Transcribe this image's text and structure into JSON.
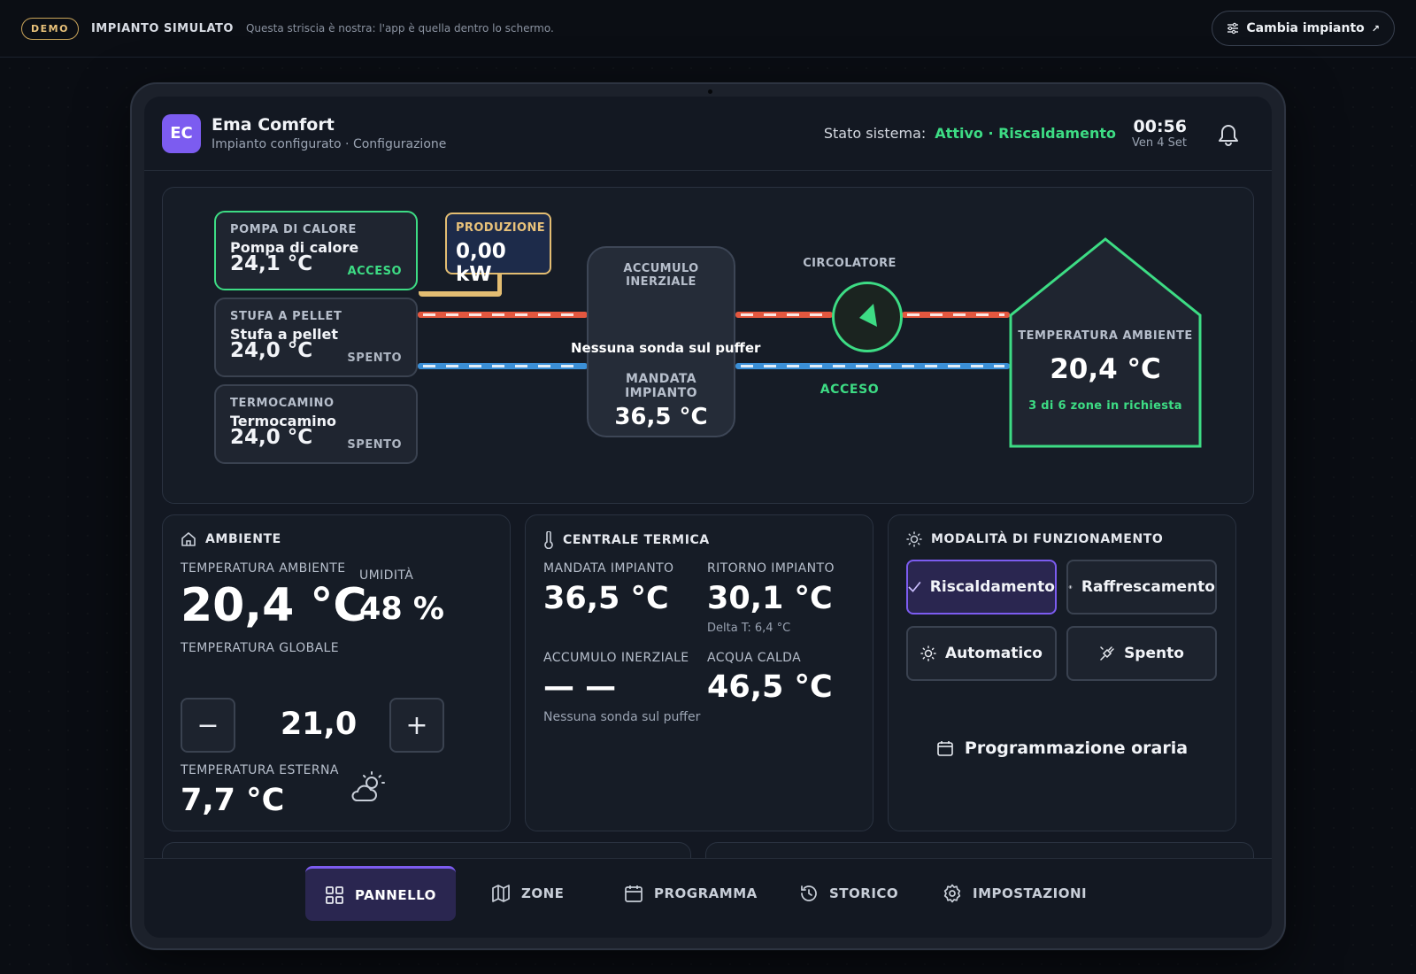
{
  "strip": {
    "badge": "DEMO",
    "title": "IMPIANTO SIMULATO",
    "note": "Questa striscia è nostra: l'app è quella dentro lo schermo.",
    "switch_label": "Cambia impianto",
    "switch_arrow": "↗"
  },
  "app": {
    "logo_initials": "EC",
    "name": "Ema Comfort",
    "subtitle": "Impianto configurato · Configurazione",
    "status_label": "Stato sistema:",
    "status_value": "Attivo · Riscaldamento",
    "time": "00:56",
    "date": "Ven 4 Set",
    "accent_color": "#7c5cf0",
    "active_color": "#3ddc84"
  },
  "diagram": {
    "sources": [
      {
        "type": "POMPA DI CALORE",
        "name": "Pompa di calore",
        "temp": "24,1 °C",
        "state": "ACCESO",
        "active": true
      },
      {
        "type": "STUFA A PELLET",
        "name": "Stufa a pellet",
        "temp": "24,0 °C",
        "state": "SPENTO",
        "active": false
      },
      {
        "type": "TERMOCAMINO",
        "name": "Termocamino",
        "temp": "24,0 °C",
        "state": "SPENTO",
        "active": false
      }
    ],
    "production": {
      "label": "PRODUZIONE",
      "value": "0,00 kW"
    },
    "tank": {
      "title": "ACCUMULO INERZIALE",
      "message": "Nessuna sonda sul puffer",
      "sub_label": "MANDATA IMPIANTO",
      "sub_value": "36,5 °C"
    },
    "circulator": {
      "label": "CIRCOLATORE",
      "state": "ACCESO"
    },
    "house": {
      "label": "TEMPERATURA AMBIENTE",
      "temp": "20,4 °C",
      "zones": "3 di 6 zone in richiesta"
    }
  },
  "ambiente": {
    "title": "AMBIENTE",
    "temp_label": "TEMPERATURA AMBIENTE",
    "temp_value": "20,4 °C",
    "humidity_label": "UMIDITÀ",
    "humidity_value": "48 %",
    "global_label": "TEMPERATURA GLOBALE",
    "setpoint": "21,0",
    "minus": "−",
    "plus": "+",
    "ext_label": "TEMPERATURA ESTERNA",
    "ext_value": "7,7 °C"
  },
  "centrale": {
    "title": "CENTRALE TERMICA",
    "mandata_label": "MANDATA IMPIANTO",
    "mandata_value": "36,5 °C",
    "ritorno_label": "RITORNO IMPIANTO",
    "ritorno_value": "30,1 °C",
    "delta": "Delta T: 6,4 °C",
    "accumulo_label": "ACCUMULO INERZIALE",
    "accumulo_value": "— —",
    "accumulo_note": "Nessuna sonda sul puffer",
    "acqua_label": "ACQUA CALDA",
    "acqua_value": "46,5 °C"
  },
  "modalita": {
    "title": "MODALITÀ DI FUNZIONAMENTO",
    "buttons": [
      "Riscaldamento",
      "Raffrescamento",
      "Automatico",
      "Spento"
    ],
    "selected": "Riscaldamento",
    "schedule": "Programmazione oraria"
  },
  "nav": {
    "items": [
      "PANNELLO",
      "ZONE",
      "PROGRAMMA",
      "STORICO",
      "IMPOSTAZIONI"
    ],
    "active": "PANNELLO"
  }
}
